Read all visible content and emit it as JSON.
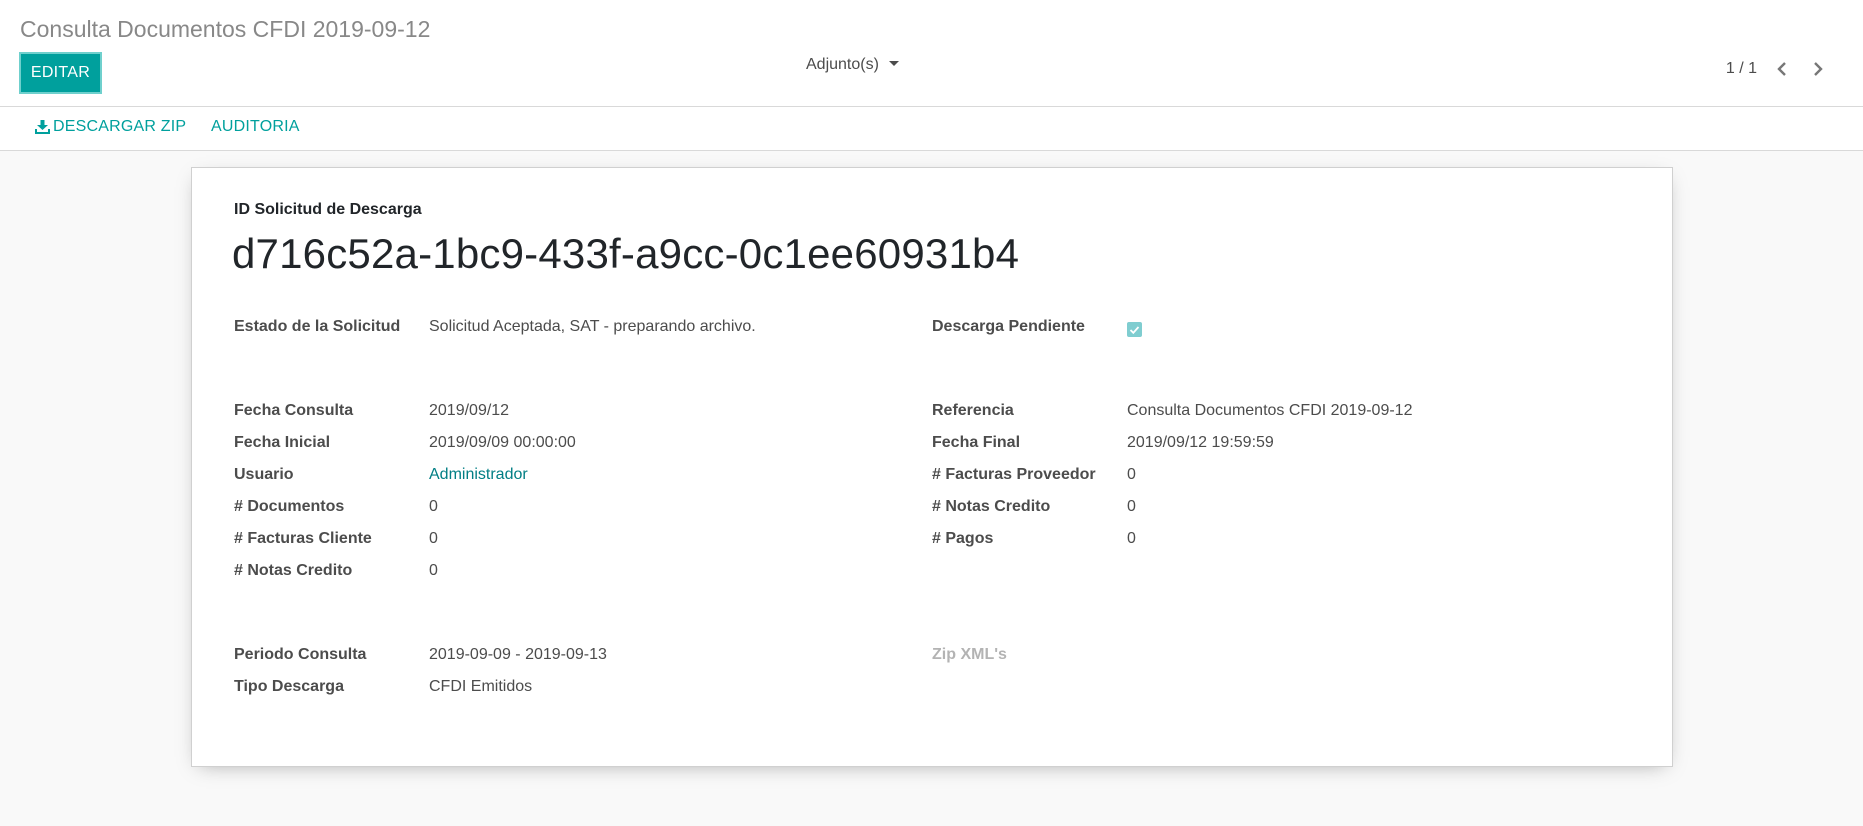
{
  "breadcrumb": "Consulta Documentos CFDI 2019-09-12",
  "toolbar": {
    "edit_label": "EDITAR",
    "attachments_label": "Adjunto(s)"
  },
  "pager": {
    "value": "1 / 1"
  },
  "actions": {
    "download_zip": "DESCARGAR ZIP",
    "audit": "AUDITORIA"
  },
  "record": {
    "title_label": "ID Solicitud de Descarga",
    "title_value": "d716c52a-1bc9-433f-a9cc-0c1ee60931b4",
    "status_label": "Estado de la Solicitud",
    "status_value": "Solicitud Aceptada, SAT - preparando archivo.",
    "pending_label": "Descarga Pendiente",
    "pending_checked": true,
    "left_fields": [
      {
        "label": "Fecha Consulta",
        "value": "2019/09/12"
      },
      {
        "label": "Fecha Inicial",
        "value": "2019/09/09 00:00:00"
      },
      {
        "label": "Usuario",
        "value": "Administrador"
      },
      {
        "label": "# Documentos",
        "value": "0"
      },
      {
        "label": "# Facturas Cliente",
        "value": "0"
      },
      {
        "label": "# Notas Credito",
        "value": "0"
      }
    ],
    "right_fields": [
      {
        "label": "Referencia",
        "value": "Consulta Documentos CFDI 2019-09-12"
      },
      {
        "label": "Fecha Final",
        "value": "2019/09/12 19:59:59"
      },
      {
        "label": "# Facturas Proveedor",
        "value": "0"
      },
      {
        "label": "# Notas Credito",
        "value": "0"
      },
      {
        "label": "# Pagos",
        "value": "0"
      }
    ],
    "period_label": "Periodo Consulta",
    "period_value": "2019-09-09 - 2019-09-13",
    "download_type_label": "Tipo Descarga",
    "download_type_value": "CFDI Emitidos",
    "zip_label": "Zip XML's"
  },
  "colors": {
    "accent": "#00a09d",
    "link": "#017e84"
  }
}
